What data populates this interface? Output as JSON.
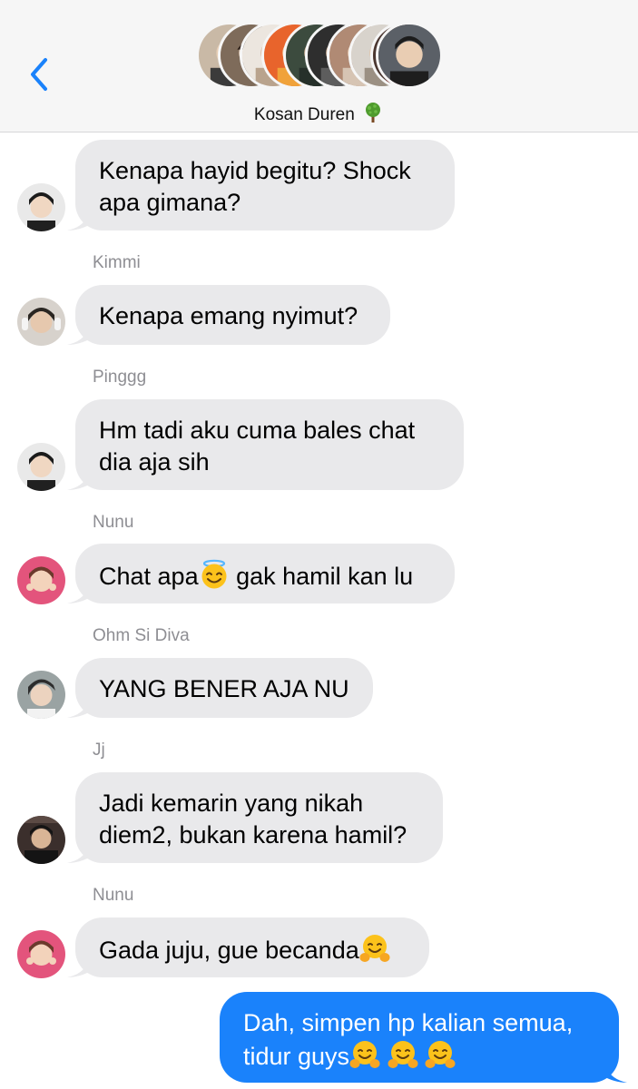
{
  "header": {
    "group_name": "Kosan Duren",
    "group_emoji": "tree-icon",
    "back_icon": "chevron-left-icon",
    "accent_color": "#1a82fb"
  },
  "messages": [
    {
      "sender": "",
      "text_lines": [
        "Kenapa hayid begitu? Shock",
        "apa gimana?"
      ],
      "outgoing": false
    },
    {
      "sender": "Kimmi",
      "text_lines": [
        "Kenapa emang nyimut?"
      ],
      "outgoing": false
    },
    {
      "sender": "Pinggg",
      "text_lines": [
        "Hm tadi aku cuma bales chat",
        "dia aja sih"
      ],
      "outgoing": false
    },
    {
      "sender": "Nunu",
      "text_parts": [
        "Chat apa",
        " gak hamil kan lu"
      ],
      "emoji": "smiling-face-with-halo",
      "outgoing": false
    },
    {
      "sender": "Ohm Si Diva",
      "text_lines": [
        "YANG BENER AJA NU"
      ],
      "outgoing": false
    },
    {
      "sender": "Jj",
      "text_lines": [
        "Jadi kemarin yang nikah",
        "diem2, bukan karena hamil?"
      ],
      "outgoing": false
    },
    {
      "sender": "Nunu",
      "text_parts": [
        "Gada juju, gue becanda"
      ],
      "emoji": "hugging-face",
      "outgoing": false
    },
    {
      "sender": "",
      "text_lines": [
        "Dah, simpen hp kalian semua,",
        "tidur guys"
      ],
      "emoji": "hugging-face",
      "outgoing": true
    }
  ],
  "colors": {
    "incoming_bubble": "#e9e9eb",
    "outgoing_bubble": "#1a82fb",
    "header_bg": "#f6f6f6",
    "sender_label": "#8e8e93"
  }
}
